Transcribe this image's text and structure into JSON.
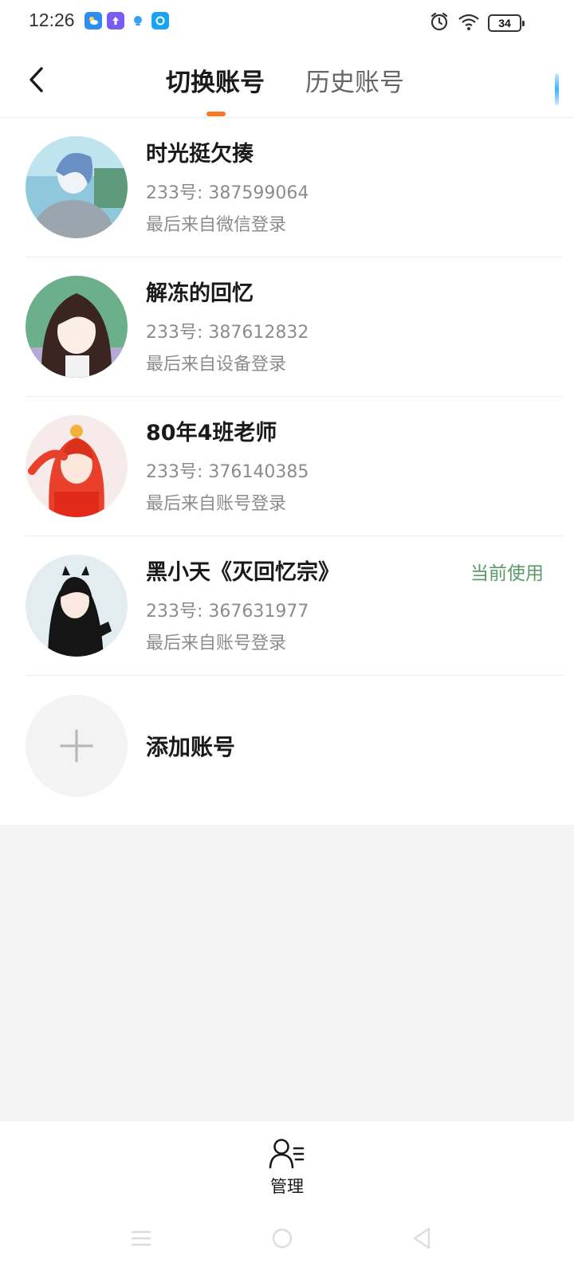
{
  "status_bar": {
    "time": "12:26",
    "battery": "34",
    "notification_icons": [
      "weather-icon",
      "upload-app-icon",
      "assistant-app-icon",
      "blue-app-icon"
    ],
    "right_icons": [
      "alarm-icon",
      "wifi-icon",
      "battery-icon"
    ]
  },
  "header": {
    "back_icon": "chevron-left-icon",
    "tabs": [
      {
        "label": "切换账号",
        "active": true
      },
      {
        "label": "历史账号",
        "active": false
      }
    ]
  },
  "accounts": [
    {
      "name": "时光挺欠揍",
      "id": "233号: 387599064",
      "login": "最后来自微信登录",
      "current": false
    },
    {
      "name": "解冻的回忆",
      "id": "233号: 387612832",
      "login": "最后来自设备登录",
      "current": false
    },
    {
      "name": "80年4班老师",
      "id": "233号: 376140385",
      "login": "最后来自账号登录",
      "current": false
    },
    {
      "name": "黑小天《灭回忆宗》",
      "id": "233号: 367631977",
      "login": "最后来自账号登录",
      "current": true
    }
  ],
  "current_badge": "当前使用",
  "add_account": {
    "label": "添加账号",
    "icon": "plus-icon"
  },
  "bottom": {
    "manage_label": "管理",
    "manage_icon": "user-list-icon"
  },
  "system_nav": [
    "menu-icon",
    "home-icon",
    "back-triangle-icon"
  ],
  "colors": {
    "accent": "#f47a2a",
    "current_green": "#5a9b68",
    "page_bg": "#f4f4f4"
  }
}
